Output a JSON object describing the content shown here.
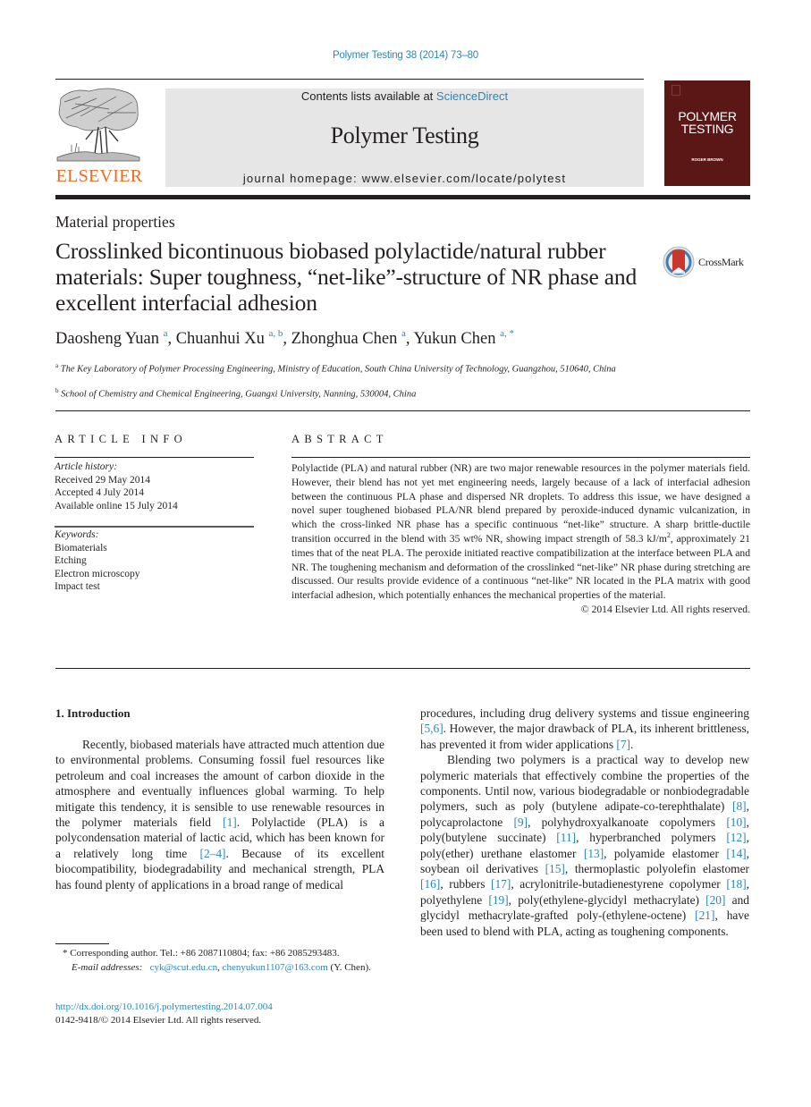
{
  "citation": "Polymer Testing 38 (2014) 73–80",
  "header": {
    "publisher_logo_text": "ELSEVIER",
    "contents_prefix": "Contents lists available at ",
    "contents_link": "ScienceDirect",
    "journal_name": "Polymer Testing",
    "homepage": "journal homepage: www.elsevier.com/locate/polytest",
    "cover_title_line1": "POLYMER",
    "cover_title_line2": "TESTING",
    "cover_editor": "ROGER BROWN",
    "brand_orange": "#f26a21",
    "link_blue": "#2a86b9",
    "cover_color": "#5b1716"
  },
  "article": {
    "section_type": "Material properties",
    "title": "Crosslinked bicontinuous biobased polylactide/natural rubber materials: Super toughness, “net-like”-structure of NR phase and excellent interfacial adhesion",
    "crossmark_label": "CrossMark",
    "authors": [
      {
        "name": "Daosheng Yuan",
        "sup": "a",
        "sep": ", "
      },
      {
        "name": "Chuanhui Xu",
        "sup": "a, b",
        "sep": ", "
      },
      {
        "name": "Zhonghua Chen",
        "sup": "a",
        "sep": ", "
      },
      {
        "name": "Yukun Chen",
        "sup": "a, *",
        "sep": ""
      }
    ],
    "affiliations": [
      {
        "mark": "a",
        "text": "The Key Laboratory of Polymer Processing Engineering, Ministry of Education, South China University of Technology, Guangzhou, 510640, China"
      },
      {
        "mark": "b",
        "text": "School of Chemistry and Chemical Engineering, Guangxi University, Nanning, 530004, China"
      }
    ]
  },
  "article_info": {
    "heading": "ARTICLE INFO",
    "history_label": "Article history:",
    "received": "Received 29 May 2014",
    "accepted": "Accepted 4 July 2014",
    "online": "Available online 15 July 2014",
    "keywords_label": "Keywords:",
    "keywords": [
      "Biomaterials",
      "Etching",
      "Electron microscopy",
      "Impact test"
    ]
  },
  "abstract": {
    "heading": "ABSTRACT",
    "text_part1": "Polylactide (PLA) and natural rubber (NR) are two major renewable resources in the polymer materials field. However, their blend has not yet met engineering needs, largely because of a lack of interfacial adhesion between the continuous PLA phase and dispersed NR droplets. To address this issue, we have designed a novel super toughened biobased PLA/NR blend prepared by peroxide-induced dynamic vulcanization, in which the cross-linked NR phase has a specific continuous “net-like” structure. A sharp brittle-ductile transition occurred in the blend with 35 wt% NR, showing impact strength of 58.3 kJ/m",
    "text_sup": "2",
    "text_part2": ", approximately 21 times that of the neat PLA. The peroxide initiated reactive compatibilization at the interface between PLA and NR. The toughening mechanism and deformation of the crosslinked “net-like” NR phase during stretching are discussed. Our results provide evidence of a continuous “net-like” NR located in the PLA matrix with good interfacial adhesion, which potentially enhances the mechanical properties of the material.",
    "copyright": "© 2014 Elsevier Ltd. All rights reserved."
  },
  "introduction": {
    "heading": "1.  Introduction",
    "p1_a": "Recently, biobased materials have attracted much attention due to environmental problems. Consuming fossil fuel resources like petroleum and coal increases the amount of carbon dioxide in the atmosphere and eventually influences global warming. To help mitigate this tendency, it is sensible to use renewable resources in the polymer materials field ",
    "ref_1": "[1]",
    "p1_b": ". Polylactide (PLA) is a polycondensation material of lactic acid, which has been known for a relatively long time ",
    "ref_2_4": "[2–4]",
    "p1_c": ". Because of its excellent biocompatibility, biodegradability and mechanical strength, PLA has found plenty of applications in a broad range of medical procedures, including drug delivery systems and tissue engineering ",
    "ref_5_6": "[5,6]",
    "p1_d": ". However, the major drawback of PLA, its inherent brittleness, has prevented it from wider applications ",
    "ref_7": "[7]",
    "p1_e": ".",
    "p2_a": "Blending two polymers is a practical way to develop new polymeric materials that effectively combine the properties of the components. Until now, various biodegradable or nonbiodegradable polymers, such as poly (butylene adipate-co-terephthalate) ",
    "refs": {
      "r8": "[8]",
      "r9": "[9]",
      "r10": "[10]",
      "r11": "[11]",
      "r12": "[12]",
      "r13": "[13]",
      "r14": "[14]",
      "r15": "[15]",
      "r16": "[16]",
      "r17": "[17]",
      "r18": "[18]",
      "r19": "[19]",
      "r20": "[20]",
      "r21": "[21]"
    },
    "t8": ", polycaprolactone ",
    "t9": ", polyhydroxyalkanoate copolymers ",
    "t10": ", poly(butylene succinate) ",
    "t11": ", hyperbranched polymers ",
    "t12": ", poly(ether) urethane elastomer ",
    "t13": ", polyamide elastomer ",
    "t14": ", soybean oil derivatives ",
    "t15": ", thermoplastic polyolefin elastomer ",
    "t16": ", rubbers ",
    "t17": ", acrylonitrile-butadienestyrene copolymer ",
    "t18": ", polyethylene ",
    "t19": ", poly(ethylene-glycidyl methacrylate) ",
    "t20": " and glycidyl methacrylate-grafted poly-(ethylene-octene) ",
    "t21": ", have been used to blend with PLA, acting as toughening components."
  },
  "footnote": {
    "corresponding": "* Corresponding author. Tel.: +86 2087110804; fax: +86 2085293483.",
    "email_label": "E-mail addresses:",
    "email1": "cyk@scut.edu.cn",
    "email_sep": ", ",
    "email2": "chenyukun1107@163.com",
    "email_suffix": " (Y. Chen).",
    "doi": "http://dx.doi.org/10.1016/j.polymertesting.2014.07.004",
    "issn_copyright": "0142-9418/© 2014 Elsevier Ltd. All rights reserved."
  }
}
